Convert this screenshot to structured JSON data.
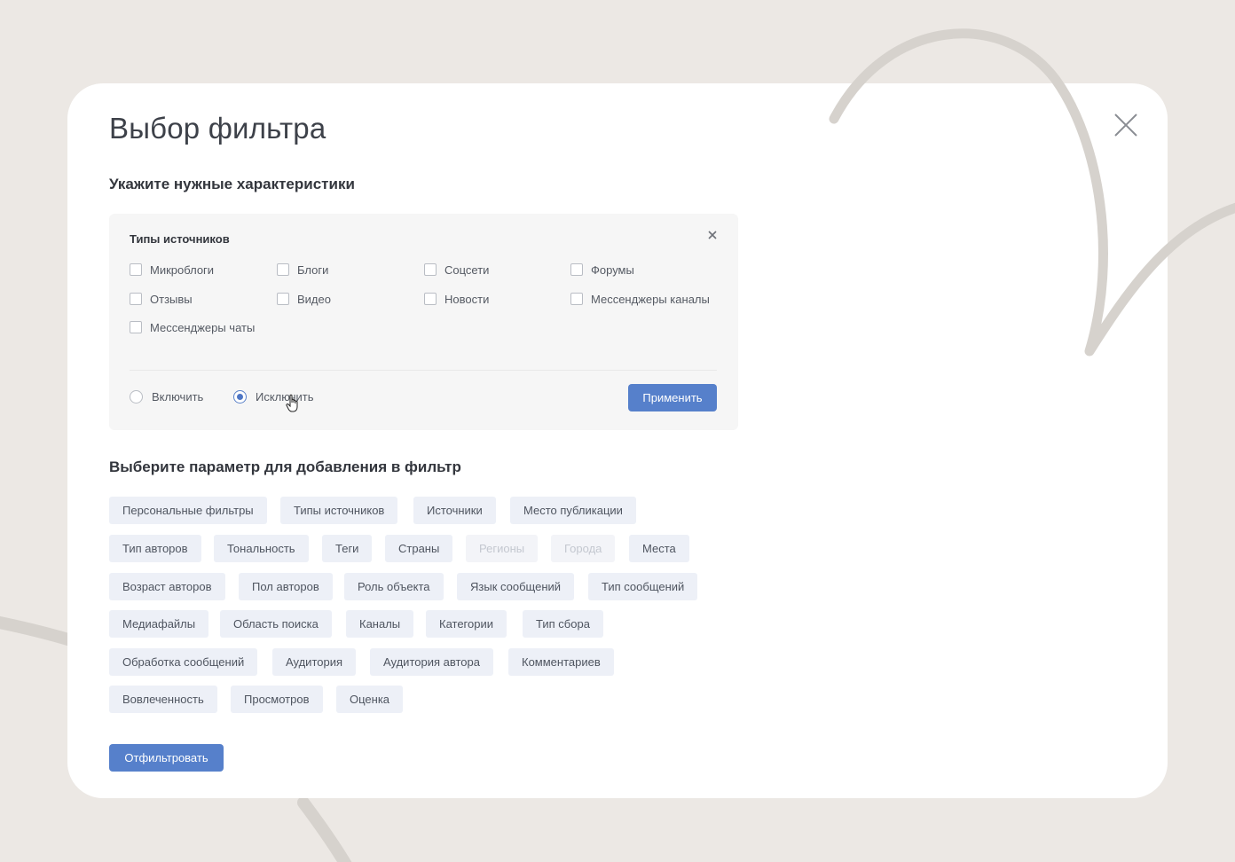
{
  "modal": {
    "title": "Выбор фильтра",
    "subtitle": "Укажите нужные характеристики",
    "close_icon": "close-icon"
  },
  "source_types_panel": {
    "title": "Типы источников",
    "close_icon": "close-icon",
    "checkboxes": [
      {
        "label": "Микроблоги",
        "checked": false
      },
      {
        "label": "Блоги",
        "checked": false
      },
      {
        "label": "Соцсети",
        "checked": false
      },
      {
        "label": "Форумы",
        "checked": false
      },
      {
        "label": "Отзывы",
        "checked": false
      },
      {
        "label": "Видео",
        "checked": false
      },
      {
        "label": "Новости",
        "checked": false
      },
      {
        "label": "Мессенджеры каналы",
        "checked": false
      },
      {
        "label": "Мессенджеры чаты",
        "checked": false
      }
    ],
    "mode": {
      "include_label": "Включить",
      "exclude_label": "Исключить",
      "selected": "exclude"
    },
    "apply_label": "Применить"
  },
  "parameters": {
    "title": "Выберите параметр для добавления в фильтр",
    "chips": [
      {
        "label": "Персональные фильтры",
        "disabled": false
      },
      {
        "label": "Типы источников",
        "disabled": false
      },
      {
        "label": "Источники",
        "disabled": false
      },
      {
        "label": "Место публикации",
        "disabled": false
      },
      {
        "label": "Тип авторов",
        "disabled": false
      },
      {
        "label": "Тональность",
        "disabled": false
      },
      {
        "label": "Теги",
        "disabled": false
      },
      {
        "label": "Страны",
        "disabled": false
      },
      {
        "label": "Регионы",
        "disabled": true
      },
      {
        "label": "Города",
        "disabled": true
      },
      {
        "label": "Места",
        "disabled": false
      },
      {
        "label": "Возраст авторов",
        "disabled": false
      },
      {
        "label": "Пол авторов",
        "disabled": false
      },
      {
        "label": "Роль объекта",
        "disabled": false
      },
      {
        "label": "Язык сообщений",
        "disabled": false
      },
      {
        "label": "Тип сообщений",
        "disabled": false
      },
      {
        "label": "Медиафайлы",
        "disabled": false
      },
      {
        "label": "Область поиска",
        "disabled": false
      },
      {
        "label": "Каналы",
        "disabled": false
      },
      {
        "label": "Категории",
        "disabled": false
      },
      {
        "label": "Тип сбора",
        "disabled": false
      },
      {
        "label": "Обработка сообщений",
        "disabled": false
      },
      {
        "label": "Аудитория",
        "disabled": false
      },
      {
        "label": "Аудитория автора",
        "disabled": false
      },
      {
        "label": "Комментариев",
        "disabled": false
      },
      {
        "label": "Вовлеченность",
        "disabled": false
      },
      {
        "label": "Просмотров",
        "disabled": false
      },
      {
        "label": "Оценка",
        "disabled": false
      }
    ]
  },
  "filter_button_label": "Отфильтровать",
  "colors": {
    "background": "#ece8e4",
    "accent": "#5680cb",
    "chip_bg": "#edf0f7"
  }
}
